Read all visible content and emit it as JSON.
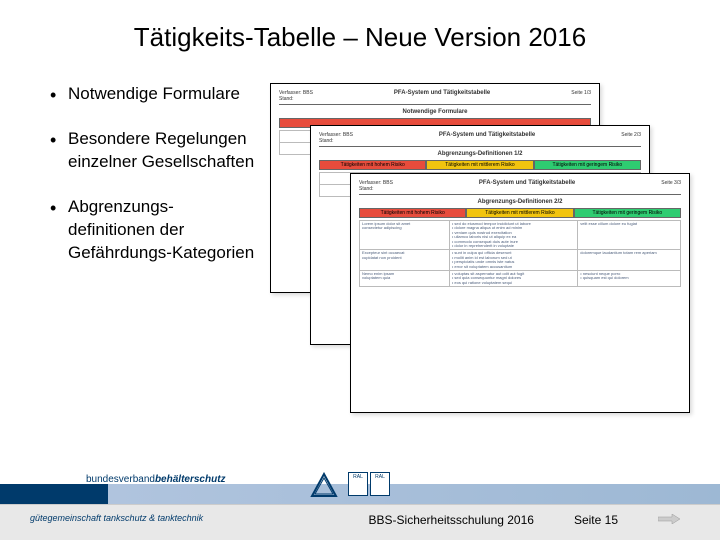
{
  "title": "Tätigkeits-Tabelle – Neue Version 2016",
  "bullets": {
    "b1": "Notwendige Formulare",
    "b2": "Besondere Regelungen einzelner Gesellschaften",
    "b3": "Abgrenzungs-definitionen der Gefährdungs-Kategorien"
  },
  "docs": {
    "header_title": "PFA-System und Tätigkeitstabelle",
    "page1": "Seite 1/3",
    "page2": "Seite 2/3",
    "page3": "Seite 3/3",
    "sub1": "Notwendige Formulare",
    "sub2": "Abgrenzungs-Definitionen 1/2",
    "sub3": "Abgrenzungs-Definitionen 2/2",
    "risk_high": "Tätigkeiten mit hohem Risiko",
    "risk_mid": "Tätigkeiten mit mittlerem Risiko",
    "risk_low": "Tätigkeiten mit geringem Risiko",
    "verf": "Verfasser",
    "stand": "Stand"
  },
  "footer": {
    "org_prefix": "bundesverband",
    "org_bold": "behälterschutz",
    "org_sub": "gütegemeinschaft tankschutz & tanktechnik",
    "ral1": "RAL",
    "ral2": "RAL",
    "course": "BBS-Sicherheitsschulung 2016",
    "page": "Seite 15"
  }
}
